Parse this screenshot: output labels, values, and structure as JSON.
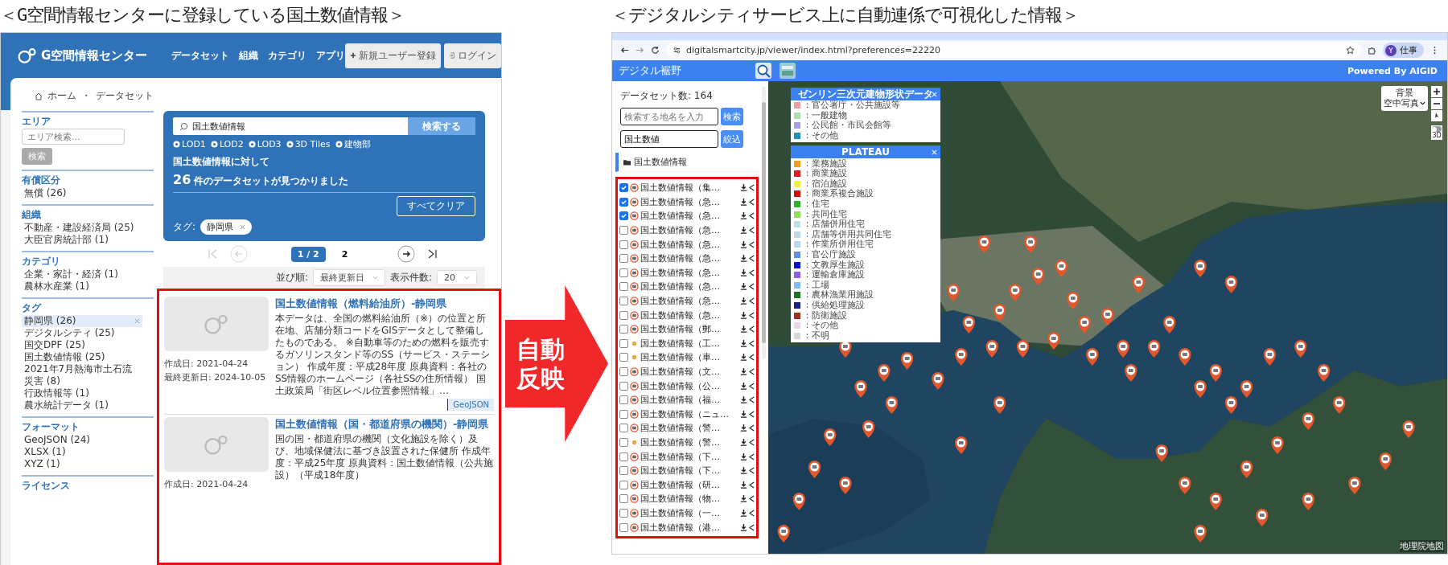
{
  "headings": {
    "left": "＜G空間情報センターに登録している国土数値情報＞",
    "right": "＜デジタルシティサービス上に自動連係で可視化した情報＞"
  },
  "arrow_label": "自動反映",
  "left_site": {
    "logo": "G空間情報センター",
    "nav": [
      "データセット",
      "組織",
      "カテゴリ",
      "アプリ"
    ],
    "register_button": "新規ユーザー登録",
    "login_button": "ログイン",
    "breadcrumb": [
      "ホーム",
      "データセット"
    ],
    "breadcrumb_separator": "・",
    "sidebar": [
      {
        "title": "エリア",
        "kind": "search",
        "placeholder": "エリア検索...",
        "button": "検索"
      },
      {
        "title": "有償区分",
        "kind": "list",
        "items": [
          {
            "label": "無償 (26)",
            "selected": false
          }
        ]
      },
      {
        "title": "組織",
        "kind": "list",
        "items": [
          {
            "label": "不動産・建設経済局 (25)",
            "selected": false
          },
          {
            "label": "大臣官房統計部 (1)",
            "selected": false
          }
        ]
      },
      {
        "title": "カテゴリ",
        "kind": "list",
        "items": [
          {
            "label": "企業・家計・経済 (1)",
            "selected": false
          },
          {
            "label": "農林水産業 (1)",
            "selected": false
          }
        ]
      },
      {
        "title": "タグ",
        "kind": "list",
        "items": [
          {
            "label": "静岡県 (26)",
            "selected": true
          },
          {
            "label": "デジタルシティ (25)",
            "selected": false
          },
          {
            "label": "国交DPF (25)",
            "selected": false
          },
          {
            "label": "国土数値情報 (25)",
            "selected": false
          },
          {
            "label": "2021年7月熱海市土石流災害 (8)",
            "selected": false
          },
          {
            "label": "行政情報等 (1)",
            "selected": false
          },
          {
            "label": "農水統計データ (1)",
            "selected": false
          }
        ]
      },
      {
        "title": "フォーマット",
        "kind": "list",
        "items": [
          {
            "label": "GeoJSON (24)",
            "selected": false
          },
          {
            "label": "XLSX (1)",
            "selected": false
          },
          {
            "label": "XYZ (1)",
            "selected": false
          }
        ]
      },
      {
        "title": "ライセンス",
        "kind": "list"
      }
    ],
    "search": {
      "value": "国土数値情報",
      "button": "検索する",
      "chips": [
        "LOD1",
        "LOD2",
        "LOD3",
        "3D Tiles",
        "建物部"
      ]
    },
    "result_prefix": "国土数値情報に対して",
    "result_count": "26",
    "result_suffix": "件のデータセットが見つかりました",
    "clear_button": "すべてクリア",
    "tag_label": "タグ:",
    "active_tags": [
      "静岡県"
    ],
    "pagination": [
      {
        "label": "1 / 2",
        "selected": true
      },
      {
        "label": "2",
        "selected": false
      }
    ],
    "sort": {
      "label": "並び順:",
      "value": "最終更新日",
      "count_label": "表示件数:",
      "count_value": "20"
    },
    "datasets": [
      {
        "title": "国土数値情報（燃料給油所）-静岡県",
        "description": "本データは、全国の燃料給油所（※）の位置と所在地、店舗分類コードをGISデータとして整備したものである。 ※自動車等のための燃料を販売するガソリンスタンド等のSS（サービス・ステーション） 作成年度：平成28年度 原典資料：各社のSS情報のホームページ（各社SSの住所情報） 国土政策局「街区レベル位置参照情報」…",
        "created": "作成日: 2021-04-24",
        "updated": "最終更新日: 2024-10-05",
        "formats": [
          "GeoJSON"
        ]
      },
      {
        "title": "国土数値情報（国・都道府県の機関）-静岡県",
        "description": "国の国・都道府県の機関（文化施設を除く）及び、地域保健法に基づき設置された保健所 作成年度：平成25年度 原典資料：国土数値情報（公共施設）（平成18年度）",
        "created": "作成日: 2021-04-24"
      }
    ]
  },
  "right_site": {
    "url": "digitalsmartcity.jp/viewer/index.html?preferences=22220",
    "profile_initial": "Y",
    "profile_name": "仕事",
    "app_title": "デジタル裾野",
    "powered_by": "Powered By AIGID",
    "dataset_count": "データセット数: 164",
    "place_search": {
      "placeholder": "検索する地名を入力",
      "button": "検索"
    },
    "filter": {
      "value": "国土数値",
      "button": "絞込"
    },
    "folder": "国土数値情報",
    "layers": [
      {
        "label": "国土数値情報（集…",
        "checked": true,
        "kind": "badge"
      },
      {
        "label": "国土数値情報（急…",
        "checked": true,
        "kind": "badge"
      },
      {
        "label": "国土数値情報（急…",
        "checked": true,
        "kind": "badge"
      },
      {
        "label": "国土数値情報（急…",
        "checked": false,
        "kind": "badge"
      },
      {
        "label": "国土数値情報（急…",
        "checked": false,
        "kind": "badge"
      },
      {
        "label": "国土数値情報（急…",
        "checked": false,
        "kind": "badge"
      },
      {
        "label": "国土数値情報（急…",
        "checked": false,
        "kind": "badge"
      },
      {
        "label": "国土数値情報（急…",
        "checked": false,
        "kind": "badge"
      },
      {
        "label": "国土数値情報（急…",
        "checked": false,
        "kind": "badge"
      },
      {
        "label": "国土数値情報（急…",
        "checked": false,
        "kind": "badge"
      },
      {
        "label": "国土数値情報（郵…",
        "checked": false,
        "kind": "badge"
      },
      {
        "label": "国土数値情報（工…",
        "checked": false,
        "kind": "dot"
      },
      {
        "label": "国土数値情報（車…",
        "checked": false,
        "kind": "dot"
      },
      {
        "label": "国土数値情報（文…",
        "checked": false,
        "kind": "badge"
      },
      {
        "label": "国土数値情報（公…",
        "checked": false,
        "kind": "badge"
      },
      {
        "label": "国土数値情報（福…",
        "checked": false,
        "kind": "badge"
      },
      {
        "label": "国土数値情報（ニュ…",
        "checked": false,
        "kind": "badge"
      },
      {
        "label": "国土数値情報（警…",
        "checked": false,
        "kind": "badge"
      },
      {
        "label": "国土数値情報（警…",
        "checked": false,
        "kind": "dot"
      },
      {
        "label": "国土数値情報（下…",
        "checked": false,
        "kind": "badge"
      },
      {
        "label": "国土数値情報（下…",
        "checked": false,
        "kind": "badge"
      },
      {
        "label": "国土数値情報（研…",
        "checked": false,
        "kind": "badge"
      },
      {
        "label": "国土数値情報（物…",
        "checked": false,
        "kind": "badge"
      },
      {
        "label": "国土数値情報（一…",
        "checked": false,
        "kind": "badge"
      },
      {
        "label": "国土数値情報（港…",
        "checked": false,
        "kind": "badge"
      }
    ],
    "legends": [
      {
        "title": "ゼンリン三次元建物形状データ",
        "items": [
          {
            "label": "：官公署庁・公共施設等",
            "color": "#e8a0a0"
          },
          {
            "label": "：一般建物",
            "color": "#a8e0a8"
          },
          {
            "label": "：公民館・市民会館等",
            "color": "#a8a0e0"
          },
          {
            "label": "：その他",
            "color": "#2090c0"
          }
        ]
      },
      {
        "title": "PLATEAU",
        "items": [
          {
            "label": "：業務施設",
            "color": "#f0a020"
          },
          {
            "label": "：商業施設",
            "color": "#e02020"
          },
          {
            "label": "：宿泊施設",
            "color": "#f0f040"
          },
          {
            "label": "：商業系複合施設",
            "color": "#d01010"
          },
          {
            "label": "：住宅",
            "color": "#30b030"
          },
          {
            "label": "：共同住宅",
            "color": "#90e060"
          },
          {
            "label": "：店舗併用住宅",
            "color": "#c0e0e8"
          },
          {
            "label": "：店舗等併用共同住宅",
            "color": "#c0d8e8"
          },
          {
            "label": "：作業所併用住宅",
            "color": "#bcd6ea"
          },
          {
            "label": "：官公庁施設",
            "color": "#6090e0"
          },
          {
            "label": "：文教厚生施設",
            "color": "#1010d0"
          },
          {
            "label": "：運輸倉庫施設",
            "color": "#9060e0"
          },
          {
            "label": "：工場",
            "color": "#80c0f0"
          },
          {
            "label": "：農林漁業用施設",
            "color": "#207020"
          },
          {
            "label": "：供給処理施設",
            "color": "#202080"
          },
          {
            "label": "：防衛施設",
            "color": "#a03020"
          },
          {
            "label": "：その他",
            "color": "#e8d8e8"
          },
          {
            "label": "：不明",
            "color": "#d8d8d8"
          }
        ]
      }
    ],
    "basemap": {
      "label": "背景",
      "value": "空中写真"
    },
    "toggle_3d": {
      "label": "3D",
      "on": false
    },
    "attribution": "地理院地図"
  }
}
